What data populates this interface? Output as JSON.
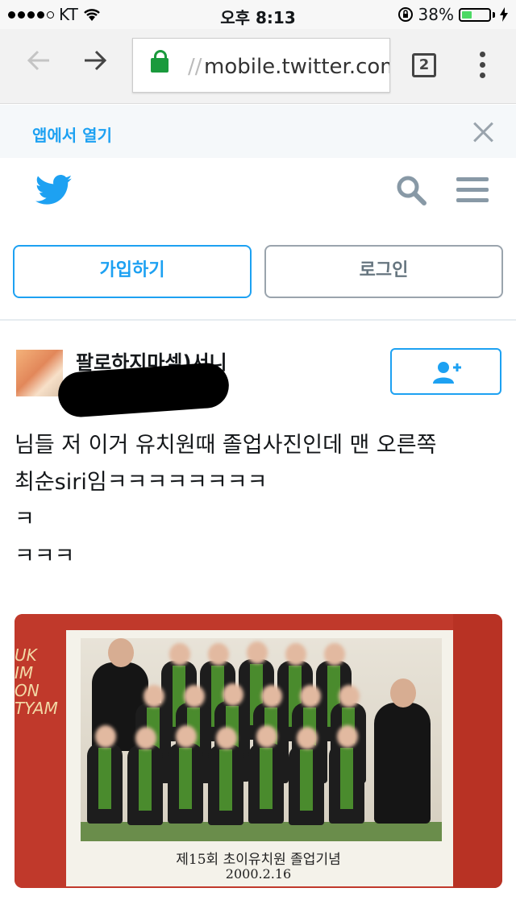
{
  "status_bar": {
    "carrier": "KT",
    "time": "오후 8:13",
    "battery_percent": "38%",
    "battery_level": 0.38
  },
  "browser": {
    "url_scheme": "//",
    "url_host": "mobile.twitter.com",
    "tab_count": "2"
  },
  "open_app_banner": {
    "label": "앱에서 열기"
  },
  "actions": {
    "signup_label": "가입하기",
    "login_label": "로그인"
  },
  "tweet": {
    "username": "팔로하지마셈)서니",
    "lines": [
      "님들 저 이거 유치원때 졸업사진인데 맨 오른쪽",
      "최순siri임ㅋㅋㅋㅋㅋㅋㅋㅋ",
      "ㅋ",
      "ㅋㅋㅋ"
    ],
    "photo": {
      "caption_line1": "제15회 초이유치원 졸업기념",
      "caption_line2": "2000.2.16",
      "stripe_text": "UK\nIM\nON\nTYAM"
    }
  },
  "colors": {
    "twitter_blue": "#1da1f2",
    "gray_icon": "#8899a6",
    "lock_green": "#1a9a3c"
  }
}
